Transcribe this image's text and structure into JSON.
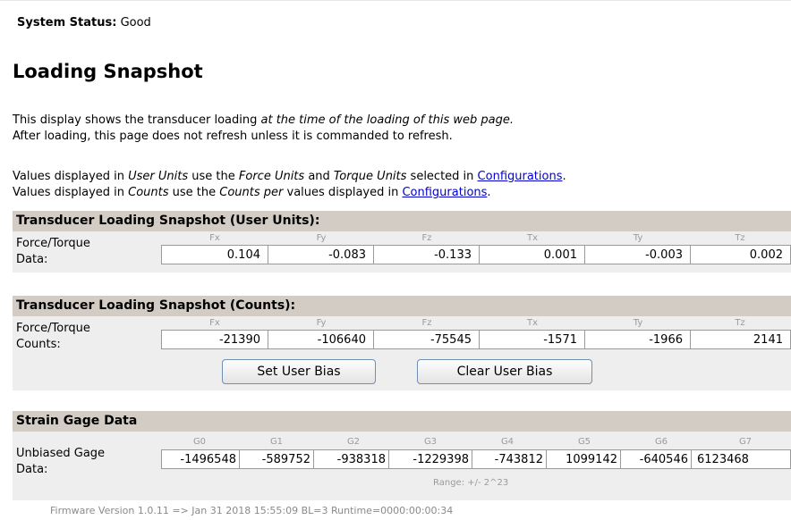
{
  "status": {
    "label": "System Status:",
    "value": "Good"
  },
  "heading": "Loading Snapshot",
  "intro": {
    "line1_start": "This display shows the transducer loading ",
    "line1_italic": "at the time of the loading of this web page.",
    "line2": "After loading, this page does not refresh unless it is commanded to refresh."
  },
  "units_note": {
    "a1": "Values displayed in ",
    "a2": "User Units",
    "a3": " use the ",
    "a4": "Force Units",
    "a5": " and ",
    "a6": "Torque Units",
    "a7": " selected in ",
    "a_link": "Configurations",
    "a8": ".",
    "b1": "Values displayed in ",
    "b2": "Counts",
    "b3": " use the ",
    "b4": "Counts per",
    "b5": " values displayed in ",
    "b_link": "Configurations",
    "b6": "."
  },
  "user_units": {
    "title": "Transducer Loading Snapshot (User Units):",
    "row_label_1": "Force/Torque",
    "row_label_2": "Data:",
    "axes": [
      "Fx",
      "Fy",
      "Fz",
      "Tx",
      "Ty",
      "Tz"
    ],
    "values": [
      "0.104",
      "-0.083",
      "-0.133",
      "0.001",
      "-0.003",
      "0.002"
    ]
  },
  "counts": {
    "title": "Transducer Loading Snapshot (Counts):",
    "row_label_1": "Force/Torque",
    "row_label_2": "Counts:",
    "axes": [
      "Fx",
      "Fy",
      "Fz",
      "Tx",
      "Ty",
      "Tz"
    ],
    "values": [
      "-21390",
      "-106640",
      "-75545",
      "-1571",
      "-1966",
      "2141"
    ]
  },
  "buttons": {
    "set_bias": "Set User Bias",
    "clear_bias": "Clear User Bias"
  },
  "strain": {
    "title": "Strain Gage Data",
    "row_label_1": "Unbiased Gage",
    "row_label_2": "Data:",
    "gages": [
      "G0",
      "G1",
      "G2",
      "G3",
      "G4",
      "G5",
      "G6",
      "G7"
    ],
    "values": [
      "-1496548",
      "-589752",
      "-938318",
      "-1229398",
      "-743812",
      "1099142",
      "-640546",
      "6123468"
    ],
    "range": "Range: +/- 2^23"
  },
  "firmware": "Firmware Version 1.0.11 => Jan 31 2018 15:55:09 BL=3 Runtime=0000:00:00:34"
}
